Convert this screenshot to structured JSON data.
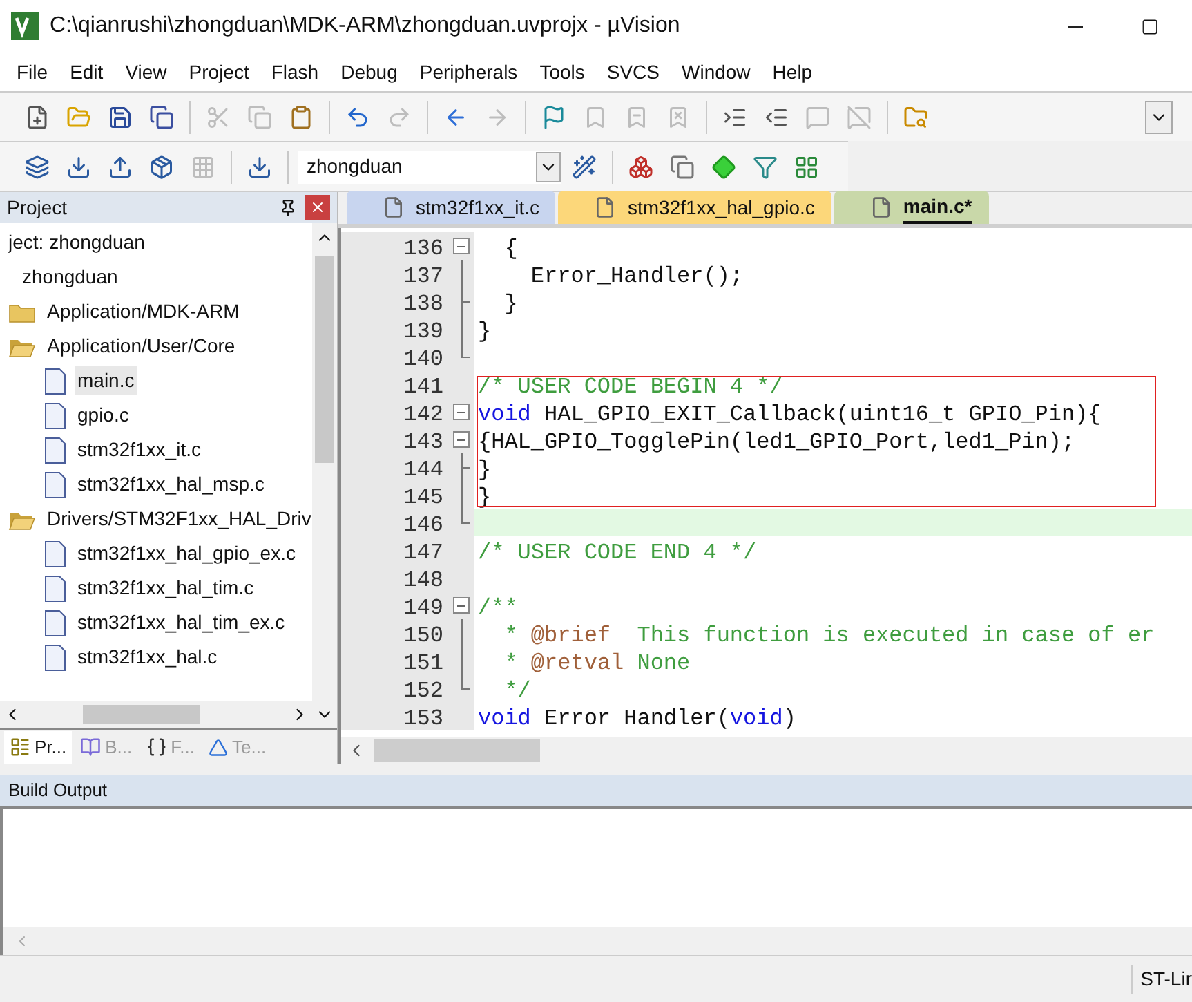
{
  "window": {
    "title": "C:\\qianrushi\\zhongduan\\MDK-ARM\\zhongduan.uvprojx - µVision"
  },
  "menu": [
    "File",
    "Edit",
    "View",
    "Project",
    "Flash",
    "Debug",
    "Peripherals",
    "Tools",
    "SVCS",
    "Window",
    "Help"
  ],
  "toolbar": [
    {
      "disabled": false
    },
    {
      "disabled": false
    },
    {
      "disabled": false
    },
    {
      "disabled": false
    },
    {
      "disabled": true
    },
    {
      "disabled": true
    },
    {
      "disabled": false
    },
    {
      "disabled": false
    },
    {
      "disabled": true
    },
    {
      "disabled": false
    },
    {
      "disabled": true
    },
    {
      "disabled": false
    },
    {
      "disabled": true
    },
    {
      "disabled": true
    },
    {
      "disabled": true
    },
    {
      "disabled": false
    },
    {
      "disabled": false
    },
    {
      "disabled": true
    },
    {
      "disabled": true
    },
    {
      "disabled": false
    }
  ],
  "build_toolbar": {
    "target": "zhongduan",
    "buttons": [
      {
        "disabled": false
      },
      {
        "disabled": false
      },
      {
        "disabled": false
      },
      {
        "disabled": false
      },
      {
        "disabled": true
      },
      {
        "disabled": false
      }
    ]
  },
  "project_panel": {
    "title": "Project",
    "tree": [
      {
        "label": "ject: zhongduan",
        "kind": "root",
        "children": [
          {
            "label": "zhongduan",
            "kind": "target",
            "children": [
              {
                "label": "Application/MDK-ARM",
                "kind": "group",
                "expanded": false
              },
              {
                "label": "Application/User/Core",
                "kind": "group",
                "expanded": true,
                "children": [
                  {
                    "label": "main.c",
                    "kind": "file",
                    "selected": true
                  },
                  {
                    "label": "gpio.c",
                    "kind": "file",
                    "selected": false
                  },
                  {
                    "label": "stm32f1xx_it.c",
                    "kind": "file",
                    "selected": false
                  },
                  {
                    "label": "stm32f1xx_hal_msp.c",
                    "kind": "file",
                    "selected": false
                  }
                ]
              },
              {
                "label": "Drivers/STM32F1xx_HAL_Driv",
                "kind": "group",
                "expanded": true,
                "children": [
                  {
                    "label": "stm32f1xx_hal_gpio_ex.c",
                    "kind": "file",
                    "selected": false
                  },
                  {
                    "label": "stm32f1xx_hal_tim.c",
                    "kind": "file",
                    "selected": false
                  },
                  {
                    "label": "stm32f1xx_hal_tim_ex.c",
                    "kind": "file",
                    "selected": false
                  },
                  {
                    "label": "stm32f1xx_hal.c",
                    "kind": "file",
                    "selected": false
                  }
                ]
              }
            ]
          }
        ]
      }
    ],
    "tabs": [
      {
        "label": "Pr...",
        "selected": true
      },
      {
        "label": "B...",
        "selected": false
      },
      {
        "label": "F...",
        "selected": false
      },
      {
        "label": "Te...",
        "selected": false
      }
    ]
  },
  "editor": {
    "tabs": [
      {
        "label": "stm32f1xx_it.c",
        "color": "#c8d5ef",
        "selected": false
      },
      {
        "label": "stm32f1xx_hal_gpio.c",
        "color": "#fcd77a",
        "selected": false
      },
      {
        "label": "main.c*",
        "color": "#c9d8a9",
        "selected": true
      }
    ],
    "lines": [
      {
        "number": "136",
        "kind": "box",
        "current": false,
        "segments": [
          {
            "kind": "code",
            "text": "  {"
          }
        ]
      },
      {
        "number": "137",
        "kind": "line",
        "current": false,
        "segments": [
          {
            "kind": "code",
            "text": "    Error_Handler();"
          }
        ]
      },
      {
        "number": "138",
        "kind": "tee",
        "current": false,
        "segments": [
          {
            "kind": "code",
            "text": "  }"
          }
        ]
      },
      {
        "number": "139",
        "kind": "line",
        "current": false,
        "segments": [
          {
            "kind": "code",
            "text": "}"
          }
        ]
      },
      {
        "number": "140",
        "kind": "end",
        "current": false
      },
      {
        "number": "141",
        "kind": "none",
        "current": false,
        "segments": [
          {
            "kind": "comment",
            "text": "/* USER CODE BEGIN 4 */"
          }
        ]
      },
      {
        "number": "142",
        "kind": "box",
        "current": false,
        "segments": [
          {
            "kind": "keyword",
            "text": "void"
          },
          {
            "kind": "code",
            "text": " HAL_GPIO_EXIT_Callback(uint16_t GPIO_Pin){"
          }
        ]
      },
      {
        "number": "143",
        "kind": "box",
        "current": false,
        "segments": [
          {
            "kind": "code",
            "text": "{HAL_GPIO_TogglePin(led1_GPIO_Port,led1_Pin);"
          }
        ]
      },
      {
        "number": "144",
        "kind": "tee",
        "current": false,
        "segments": [
          {
            "kind": "code",
            "text": "}"
          }
        ]
      },
      {
        "number": "145",
        "kind": "line",
        "current": false,
        "segments": [
          {
            "kind": "code",
            "text": "}"
          }
        ]
      },
      {
        "number": "146",
        "kind": "end",
        "current": true
      },
      {
        "number": "147",
        "kind": "none",
        "current": false,
        "segments": [
          {
            "kind": "comment",
            "text": "/* USER CODE END 4 */"
          }
        ]
      },
      {
        "number": "148",
        "kind": "none",
        "current": false
      },
      {
        "number": "149",
        "kind": "box",
        "current": false,
        "segments": [
          {
            "kind": "comment",
            "text": "/**"
          }
        ]
      },
      {
        "number": "150",
        "kind": "line",
        "current": false,
        "segments": [
          {
            "kind": "comment",
            "text": "  * "
          },
          {
            "kind": "tag",
            "text": "@brief"
          },
          {
            "kind": "comment",
            "text": "  This function is executed in case of er"
          }
        ]
      },
      {
        "number": "151",
        "kind": "line",
        "current": false,
        "segments": [
          {
            "kind": "comment",
            "text": "  * "
          },
          {
            "kind": "tag",
            "text": "@retval"
          },
          {
            "kind": "comment",
            "text": " None"
          }
        ]
      },
      {
        "number": "152",
        "kind": "end",
        "current": false,
        "segments": [
          {
            "kind": "comment",
            "text": "  */"
          }
        ]
      },
      {
        "number": "153",
        "kind": "none",
        "current": false,
        "segments": [
          {
            "kind": "keyword",
            "text": "void"
          },
          {
            "kind": "code",
            "text": " Error Handler("
          },
          {
            "kind": "keyword",
            "text": "void"
          },
          {
            "kind": "code",
            "text": ")"
          }
        ]
      }
    ]
  },
  "build_output": {
    "title": "Build Output"
  },
  "status_bar": {
    "debugger": "ST-Lir"
  }
}
